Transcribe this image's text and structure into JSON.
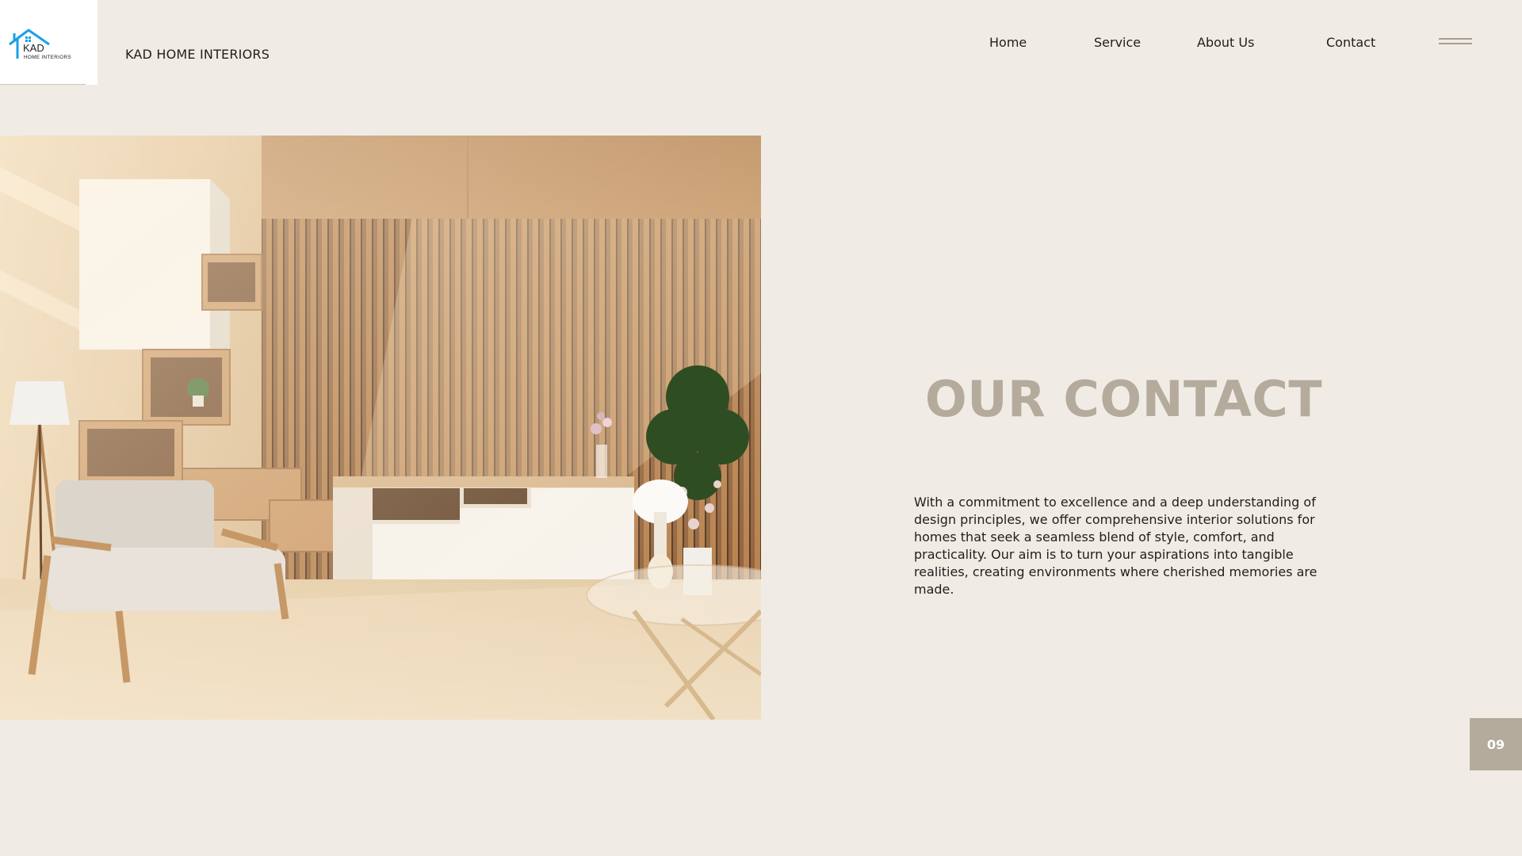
{
  "brand": {
    "logo_text": "KAD",
    "logo_subtext": "HOME INTERIORS",
    "name": "KAD HOME INTERIORS"
  },
  "nav": {
    "items": [
      {
        "label": "Home"
      },
      {
        "label": "Service"
      },
      {
        "label": "About Us"
      },
      {
        "label": "Contact"
      }
    ]
  },
  "main": {
    "title": "OUR CONTACT",
    "description": "With a commitment to excellence and a deep understanding of design principles, we offer comprehensive interior solutions for homes that seek a seamless blend of style, comfort, and practicality. Our aim is to turn your aspirations into tangible realities, creating environments where cherished memories are made."
  },
  "page_number": "09",
  "colors": {
    "background": "#f0ece5",
    "accent": "#b4ab9c",
    "logo_blue": "#1aa0e6"
  },
  "icons": {
    "logo": "house-roof-icon",
    "menu": "hamburger-menu-icon"
  }
}
